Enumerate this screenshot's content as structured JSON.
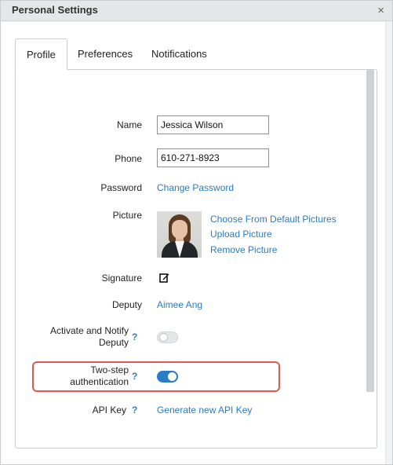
{
  "window": {
    "title": "Personal Settings",
    "close_symbol": "×"
  },
  "tabs": [
    {
      "label": "Profile",
      "active": true
    },
    {
      "label": "Preferences",
      "active": false
    },
    {
      "label": "Notifications",
      "active": false
    }
  ],
  "form": {
    "name": {
      "label": "Name",
      "value": "Jessica Wilson"
    },
    "phone": {
      "label": "Phone",
      "value": "610-271-8923"
    },
    "password": {
      "label": "Password",
      "link": "Change Password"
    },
    "picture": {
      "label": "Picture",
      "links": [
        "Choose From Default Pictures",
        "Upload Picture",
        "Remove Picture"
      ]
    },
    "signature": {
      "label": "Signature",
      "icon": "edit-icon"
    },
    "deputy": {
      "label": "Deputy",
      "value": "Aimee Ang"
    },
    "activate_notify": {
      "label_line1": "Activate and Notify",
      "label_line2": "Deputy",
      "help": "?",
      "enabled": false
    },
    "two_step": {
      "label_line1": "Two-step",
      "label_line2": "authentication",
      "help": "?",
      "enabled": true
    },
    "api_key": {
      "label": "API Key",
      "help": "?",
      "link": "Generate new API Key"
    }
  },
  "colors": {
    "link": "#2a7bc8",
    "toggle_on": "#2a7bc8",
    "highlight": "#e15759"
  }
}
